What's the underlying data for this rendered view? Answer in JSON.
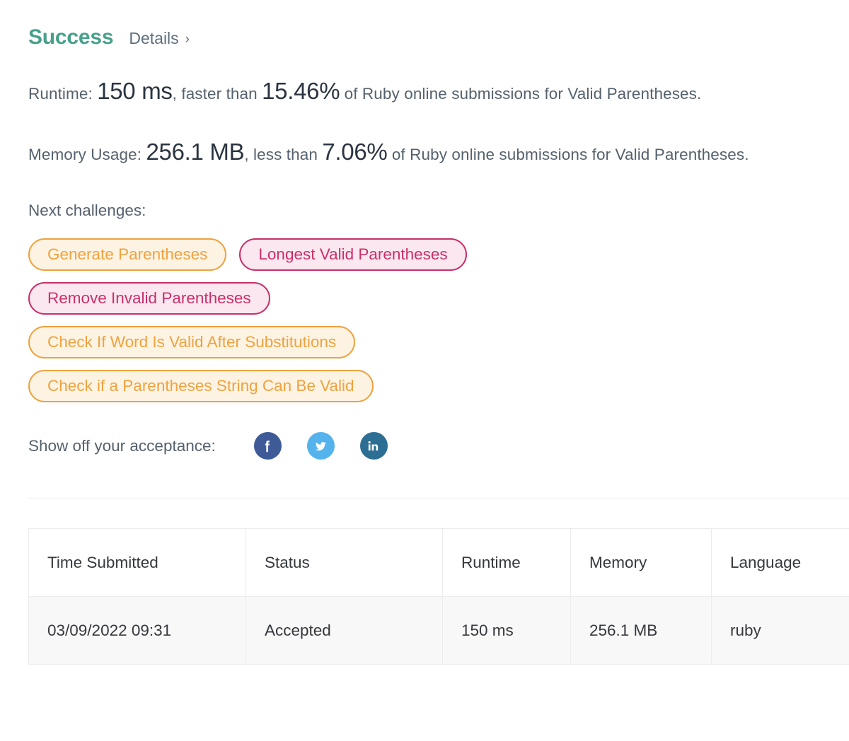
{
  "header": {
    "status_title": "Success",
    "details_label": "Details",
    "details_chevron": "chevron-right-icon"
  },
  "stats": {
    "runtime": {
      "label": "Runtime:",
      "value": "150 ms",
      "comma": ",",
      "comparator": "faster than",
      "percentile": "15.46%",
      "suffix": "of Ruby online submissions for Valid Parentheses."
    },
    "memory": {
      "label": "Memory Usage:",
      "value": "256.1 MB",
      "comma": ",",
      "comparator": "less than",
      "percentile": "7.06%",
      "suffix": "of Ruby online submissions for Valid Parentheses."
    }
  },
  "next_challenges": {
    "label": "Next challenges:",
    "items": [
      {
        "label": "Generate Parentheses",
        "difficulty": "medium"
      },
      {
        "label": "Longest Valid Parentheses",
        "difficulty": "hard"
      },
      {
        "label": "Remove Invalid Parentheses",
        "difficulty": "hard"
      },
      {
        "label": "Check If Word Is Valid After Substitutions",
        "difficulty": "medium"
      },
      {
        "label": "Check if a Parentheses String Can Be Valid",
        "difficulty": "medium"
      }
    ]
  },
  "share": {
    "label": "Show off your acceptance:",
    "buttons": [
      {
        "name": "facebook-icon",
        "title": "Facebook",
        "color": "#3e5b98"
      },
      {
        "name": "twitter-icon",
        "title": "Twitter",
        "color": "#54b3ec"
      },
      {
        "name": "linkedin-icon",
        "title": "LinkedIn",
        "color": "#2d6e94"
      }
    ]
  },
  "submissions_table": {
    "columns": [
      "Time Submitted",
      "Status",
      "Runtime",
      "Memory",
      "Language"
    ],
    "rows": [
      {
        "time_submitted": "03/09/2022 09:31",
        "status": "Accepted",
        "runtime": "150 ms",
        "memory": "256.1 MB",
        "language": "ruby"
      }
    ]
  },
  "colors": {
    "success_green": "#47a08b",
    "accepted_green": "#3c9e88",
    "body_text": "#55616d",
    "strong_text": "#2b3440",
    "medium_accent": "#efa23f",
    "medium_bg": "#fdf3e2",
    "hard_accent": "#c9306b",
    "hard_bg": "#fae7ef",
    "border": "#ececee",
    "row_bg": "#f8f8f9"
  }
}
